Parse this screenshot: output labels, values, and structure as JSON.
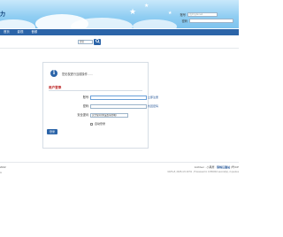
{
  "header": {
    "logo_fragment": "力",
    "username_label": "账号",
    "username_placeholder": "用户名/Email",
    "password_label": "密码"
  },
  "nav": {
    "items": [
      "首页",
      "影视",
      "音频"
    ]
  },
  "search": {
    "placeholder": "搜索"
  },
  "panel": {
    "notice": "您无权进行当前操作……",
    "section_title": "用户登录",
    "username_label": "账号:",
    "username_link": "立即注册",
    "password_label": "密码:",
    "password_link": "找回密码",
    "question_label": "安全提问:",
    "question_value": "安全提问(未设置请忽略)",
    "remember_label": "自动登录",
    "submit_label": "登录"
  },
  "footer": {
    "left_line1": "2022",
    "left_line2": "n",
    "right_line1_prefix": "Archiver ·",
    "right_line1_mid": "小黑屋 ·",
    "right_line1_bold": "狼蛛巨靠站",
    "right_line1_suffix": "(粤ICP",
    "right_line2": "GMT+8, 2025-4-5 20:51 , Processed in 0.053232 second(s), 2 queries"
  }
}
